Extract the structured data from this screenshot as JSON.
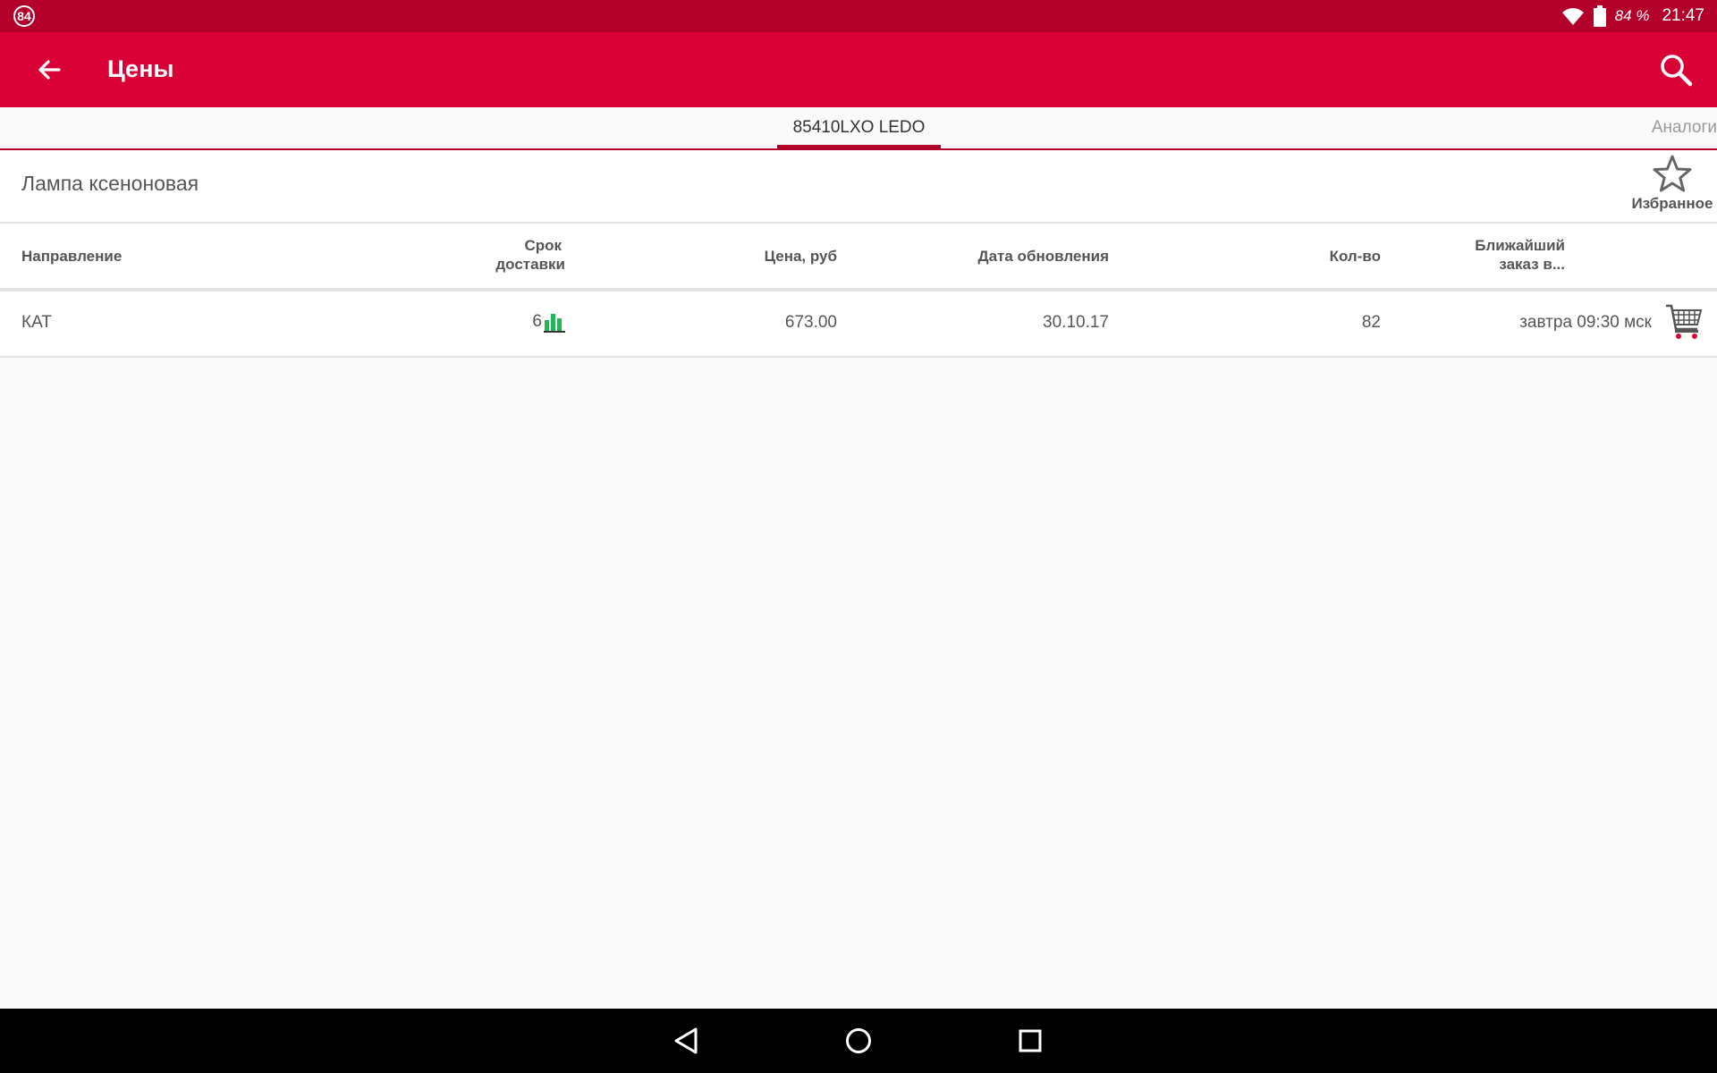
{
  "status_bar": {
    "notification_badge": "84",
    "battery_text": "84 %",
    "time": "21:47",
    "icons": [
      "wifi-icon",
      "battery-icon"
    ]
  },
  "toolbar": {
    "title": "Цены",
    "back_icon": "arrow-left-icon",
    "search_icon": "search-icon"
  },
  "tabs": {
    "active": "85410LXO LEDO",
    "inactive": "Аналоги"
  },
  "product": {
    "name": "Лампа ксеноновая",
    "favorite_label": "Избранное",
    "favorite_icon": "star-outline-icon"
  },
  "table": {
    "headers": {
      "direction": "Направление",
      "term_line1": "Срок",
      "term_line2": "доставки",
      "price": "Цена, руб",
      "date": "Дата обновления",
      "qty": "Кол-во",
      "nearest_line1": "Ближайший",
      "nearest_line2": "заказ в..."
    },
    "rows": [
      {
        "direction": "КАТ",
        "term": "6",
        "price": "673.00",
        "date": "30.10.17",
        "qty": "82",
        "nearest": "завтра 09:30 мск",
        "stats_icon": "bar-chart-icon",
        "cart_icon": "cart-icon"
      }
    ]
  },
  "nav_bar": {
    "back": "nav-back-icon",
    "home": "nav-home-icon",
    "recents": "nav-recents-icon"
  },
  "colors": {
    "status_bar": "#b3002b",
    "toolbar": "#d90036",
    "accent": "#b3002b",
    "chart_green": "#1db954"
  }
}
